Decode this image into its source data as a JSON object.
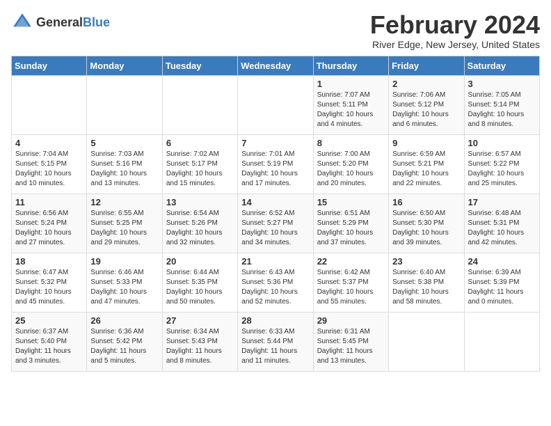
{
  "header": {
    "logo_general": "General",
    "logo_blue": "Blue",
    "title": "February 2024",
    "location": "River Edge, New Jersey, United States"
  },
  "calendar": {
    "days_of_week": [
      "Sunday",
      "Monday",
      "Tuesday",
      "Wednesday",
      "Thursday",
      "Friday",
      "Saturday"
    ],
    "weeks": [
      [
        {
          "day": "",
          "info": ""
        },
        {
          "day": "",
          "info": ""
        },
        {
          "day": "",
          "info": ""
        },
        {
          "day": "",
          "info": ""
        },
        {
          "day": "1",
          "info": "Sunrise: 7:07 AM\nSunset: 5:11 PM\nDaylight: 10 hours\nand 4 minutes."
        },
        {
          "day": "2",
          "info": "Sunrise: 7:06 AM\nSunset: 5:12 PM\nDaylight: 10 hours\nand 6 minutes."
        },
        {
          "day": "3",
          "info": "Sunrise: 7:05 AM\nSunset: 5:14 PM\nDaylight: 10 hours\nand 8 minutes."
        }
      ],
      [
        {
          "day": "4",
          "info": "Sunrise: 7:04 AM\nSunset: 5:15 PM\nDaylight: 10 hours\nand 10 minutes."
        },
        {
          "day": "5",
          "info": "Sunrise: 7:03 AM\nSunset: 5:16 PM\nDaylight: 10 hours\nand 13 minutes."
        },
        {
          "day": "6",
          "info": "Sunrise: 7:02 AM\nSunset: 5:17 PM\nDaylight: 10 hours\nand 15 minutes."
        },
        {
          "day": "7",
          "info": "Sunrise: 7:01 AM\nSunset: 5:19 PM\nDaylight: 10 hours\nand 17 minutes."
        },
        {
          "day": "8",
          "info": "Sunrise: 7:00 AM\nSunset: 5:20 PM\nDaylight: 10 hours\nand 20 minutes."
        },
        {
          "day": "9",
          "info": "Sunrise: 6:59 AM\nSunset: 5:21 PM\nDaylight: 10 hours\nand 22 minutes."
        },
        {
          "day": "10",
          "info": "Sunrise: 6:57 AM\nSunset: 5:22 PM\nDaylight: 10 hours\nand 25 minutes."
        }
      ],
      [
        {
          "day": "11",
          "info": "Sunrise: 6:56 AM\nSunset: 5:24 PM\nDaylight: 10 hours\nand 27 minutes."
        },
        {
          "day": "12",
          "info": "Sunrise: 6:55 AM\nSunset: 5:25 PM\nDaylight: 10 hours\nand 29 minutes."
        },
        {
          "day": "13",
          "info": "Sunrise: 6:54 AM\nSunset: 5:26 PM\nDaylight: 10 hours\nand 32 minutes."
        },
        {
          "day": "14",
          "info": "Sunrise: 6:52 AM\nSunset: 5:27 PM\nDaylight: 10 hours\nand 34 minutes."
        },
        {
          "day": "15",
          "info": "Sunrise: 6:51 AM\nSunset: 5:29 PM\nDaylight: 10 hours\nand 37 minutes."
        },
        {
          "day": "16",
          "info": "Sunrise: 6:50 AM\nSunset: 5:30 PM\nDaylight: 10 hours\nand 39 minutes."
        },
        {
          "day": "17",
          "info": "Sunrise: 6:48 AM\nSunset: 5:31 PM\nDaylight: 10 hours\nand 42 minutes."
        }
      ],
      [
        {
          "day": "18",
          "info": "Sunrise: 6:47 AM\nSunset: 5:32 PM\nDaylight: 10 hours\nand 45 minutes."
        },
        {
          "day": "19",
          "info": "Sunrise: 6:46 AM\nSunset: 5:33 PM\nDaylight: 10 hours\nand 47 minutes."
        },
        {
          "day": "20",
          "info": "Sunrise: 6:44 AM\nSunset: 5:35 PM\nDaylight: 10 hours\nand 50 minutes."
        },
        {
          "day": "21",
          "info": "Sunrise: 6:43 AM\nSunset: 5:36 PM\nDaylight: 10 hours\nand 52 minutes."
        },
        {
          "day": "22",
          "info": "Sunrise: 6:42 AM\nSunset: 5:37 PM\nDaylight: 10 hours\nand 55 minutes."
        },
        {
          "day": "23",
          "info": "Sunrise: 6:40 AM\nSunset: 5:38 PM\nDaylight: 10 hours\nand 58 minutes."
        },
        {
          "day": "24",
          "info": "Sunrise: 6:39 AM\nSunset: 5:39 PM\nDaylight: 11 hours\nand 0 minutes."
        }
      ],
      [
        {
          "day": "25",
          "info": "Sunrise: 6:37 AM\nSunset: 5:40 PM\nDaylight: 11 hours\nand 3 minutes."
        },
        {
          "day": "26",
          "info": "Sunrise: 6:36 AM\nSunset: 5:42 PM\nDaylight: 11 hours\nand 5 minutes."
        },
        {
          "day": "27",
          "info": "Sunrise: 6:34 AM\nSunset: 5:43 PM\nDaylight: 11 hours\nand 8 minutes."
        },
        {
          "day": "28",
          "info": "Sunrise: 6:33 AM\nSunset: 5:44 PM\nDaylight: 11 hours\nand 11 minutes."
        },
        {
          "day": "29",
          "info": "Sunrise: 6:31 AM\nSunset: 5:45 PM\nDaylight: 11 hours\nand 13 minutes."
        },
        {
          "day": "",
          "info": ""
        },
        {
          "day": "",
          "info": ""
        }
      ]
    ]
  }
}
